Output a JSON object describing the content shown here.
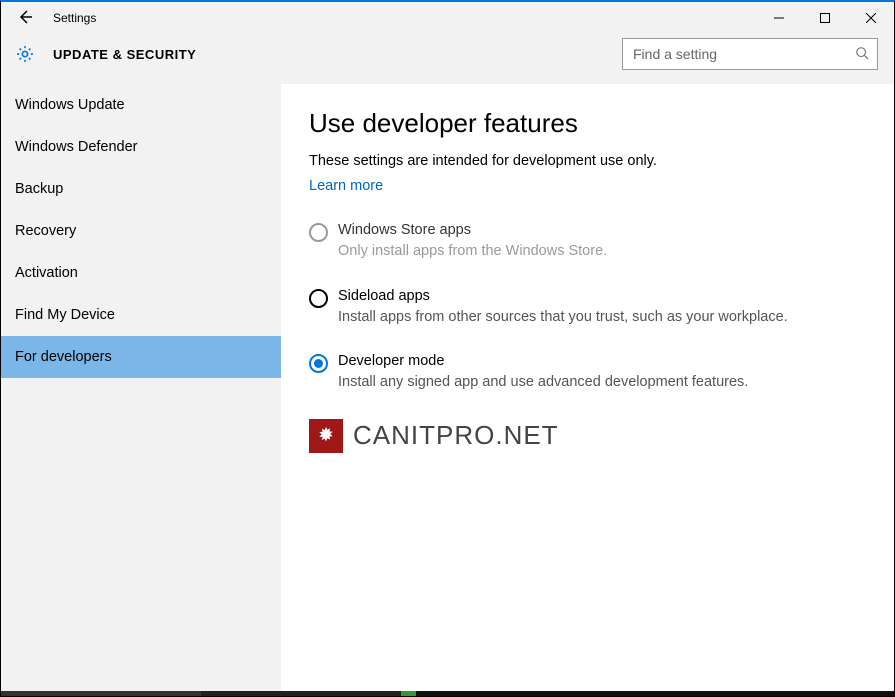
{
  "window": {
    "title": "Settings"
  },
  "header": {
    "title": "UPDATE & SECURITY"
  },
  "search": {
    "placeholder": "Find a setting"
  },
  "sidebar": {
    "items": [
      {
        "label": "Windows Update",
        "selected": false
      },
      {
        "label": "Windows Defender",
        "selected": false
      },
      {
        "label": "Backup",
        "selected": false
      },
      {
        "label": "Recovery",
        "selected": false
      },
      {
        "label": "Activation",
        "selected": false
      },
      {
        "label": "Find My Device",
        "selected": false
      },
      {
        "label": "For developers",
        "selected": true
      }
    ]
  },
  "content": {
    "heading": "Use developer features",
    "intro": "These settings are intended for development use only.",
    "learn_more": "Learn more",
    "options": [
      {
        "title": "Windows Store apps",
        "description": "Only install apps from the Windows Store.",
        "state": "disabled"
      },
      {
        "title": "Sideload apps",
        "description": "Install apps from other sources that you trust, such as your workplace.",
        "state": "normal"
      },
      {
        "title": "Developer mode",
        "description": "Install any signed app and use advanced development features.",
        "state": "selected"
      }
    ]
  },
  "watermark": {
    "text": "CANITPRO.NET"
  }
}
